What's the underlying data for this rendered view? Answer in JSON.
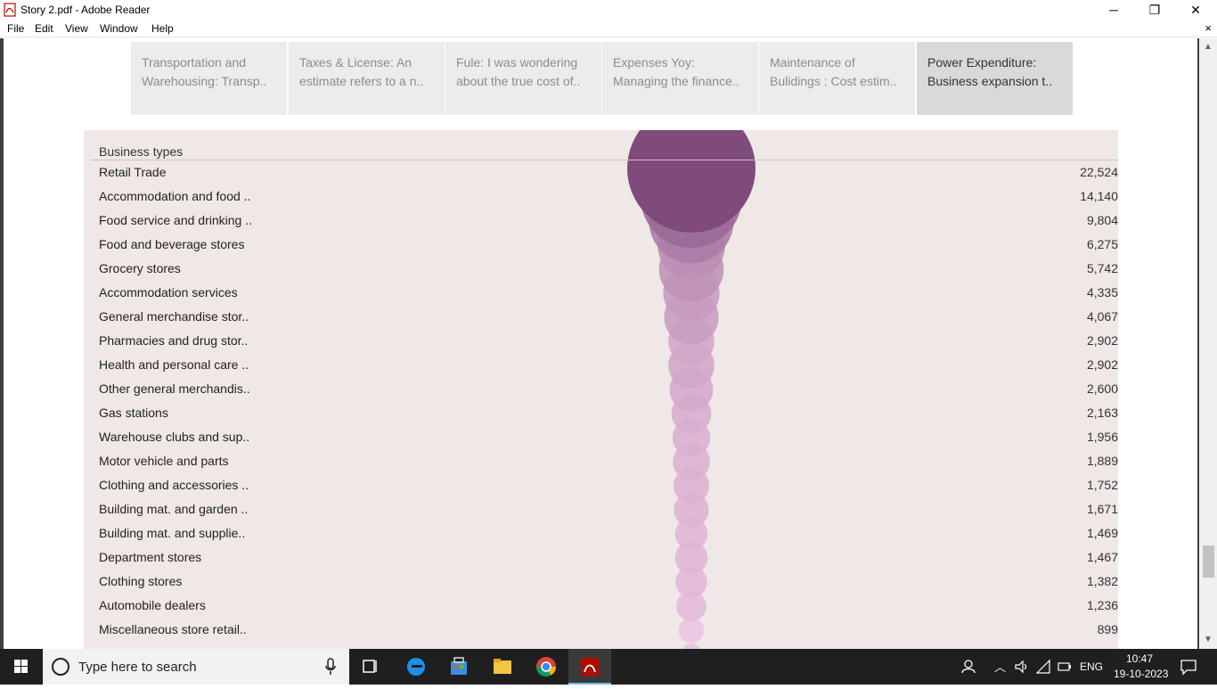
{
  "window": {
    "title": "Story 2.pdf - Adobe Reader",
    "minimize_glyph": "─",
    "maximize_glyph": "❐",
    "close_glyph": "✕"
  },
  "menu": {
    "items": [
      "File",
      "Edit",
      "View",
      "Window",
      "Help"
    ],
    "close_doc_glyph": "×"
  },
  "story_tabs": [
    {
      "line1": "Transportation and",
      "line2": "Warehousing: Transp..",
      "active": false
    },
    {
      "line1": "Taxes & License: An",
      "line2": "estimate refers to a n..",
      "active": false
    },
    {
      "line1": "Fule: I was wondering",
      "line2": "about the true cost of..",
      "active": false
    },
    {
      "line1": "Expenses Yoy:",
      "line2": "Managing the finance..",
      "active": false
    },
    {
      "line1": "Maintenance of",
      "line2": "Bulidings : Cost estim..",
      "active": false
    },
    {
      "line1": "Power Expenditure:",
      "line2": "Business expansion t..",
      "active": true
    }
  ],
  "chart_data": {
    "type": "table",
    "column_header": "Business types",
    "rows": [
      {
        "label": "Retail Trade",
        "value": "22,524",
        "num": 22524
      },
      {
        "label": "Accommodation and food ..",
        "value": "14,140",
        "num": 14140
      },
      {
        "label": "Food service and drinking ..",
        "value": "9,804",
        "num": 9804
      },
      {
        "label": "Food and beverage stores",
        "value": "6,275",
        "num": 6275
      },
      {
        "label": "Grocery stores",
        "value": "5,742",
        "num": 5742
      },
      {
        "label": "Accommodation services",
        "value": "4,335",
        "num": 4335
      },
      {
        "label": "General merchandise stor..",
        "value": "4,067",
        "num": 4067
      },
      {
        "label": "Pharmacies and drug stor..",
        "value": "2,902",
        "num": 2902
      },
      {
        "label": "Health and personal care ..",
        "value": "2,902",
        "num": 2902
      },
      {
        "label": "Other general merchandis..",
        "value": "2,600",
        "num": 2600
      },
      {
        "label": "Gas stations",
        "value": "2,163",
        "num": 2163
      },
      {
        "label": "Warehouse clubs and sup..",
        "value": "1,956",
        "num": 1956
      },
      {
        "label": "Motor vehicle and parts",
        "value": "1,889",
        "num": 1889
      },
      {
        "label": "Clothing and accessories ..",
        "value": "1,752",
        "num": 1752
      },
      {
        "label": "Building mat. and garden ..",
        "value": "1,671",
        "num": 1671
      },
      {
        "label": "Building mat. and supplie..",
        "value": "1,469",
        "num": 1469
      },
      {
        "label": "Department stores",
        "value": "1,467",
        "num": 1467
      },
      {
        "label": "Clothing stores",
        "value": "1,382",
        "num": 1382
      },
      {
        "label": "Automobile dealers",
        "value": "1,236",
        "num": 1236
      },
      {
        "label": "Miscellaneous store retail..",
        "value": "899",
        "num": 899
      }
    ],
    "colors": {
      "max": "#7e4b7b",
      "min": "#ecc4e2"
    }
  },
  "taskbar": {
    "search_placeholder": "Type here to search",
    "language": "ENG",
    "time": "10:47",
    "date": "19-10-2023"
  }
}
